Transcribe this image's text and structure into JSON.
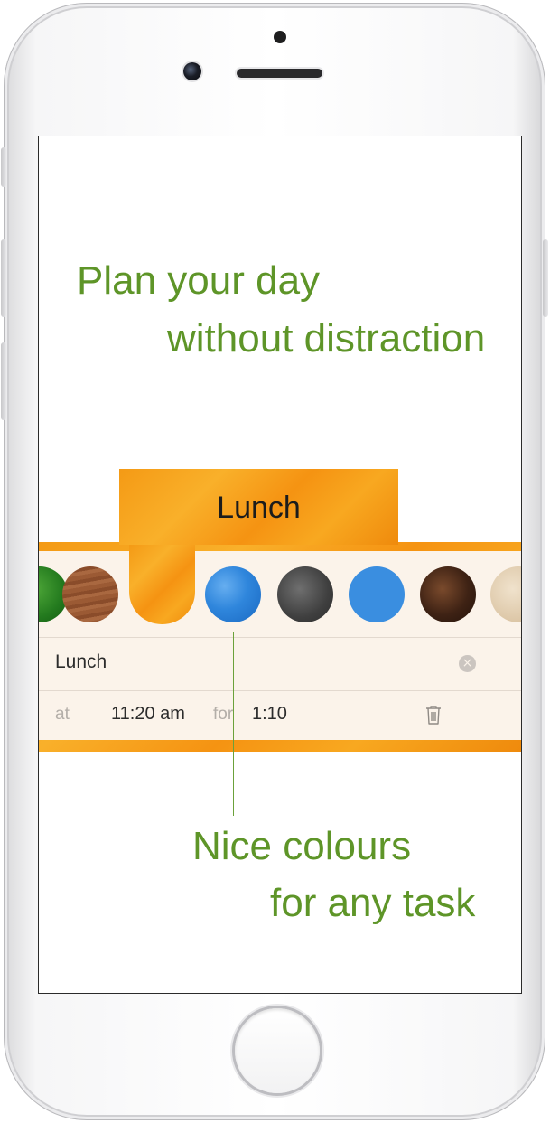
{
  "headline": {
    "line1": "Plan your day",
    "line2": "without distraction"
  },
  "task_tab": {
    "title": "Lunch"
  },
  "color_picker": {
    "swatches": [
      {
        "icon": "green-swatch",
        "color": "#2e8a24"
      },
      {
        "icon": "wood-swatch",
        "color": "#995633"
      },
      {
        "icon": "orange-swatch",
        "color": "#f59a15",
        "selected": true
      },
      {
        "icon": "blue-texture-swatch",
        "color": "#2f86dc"
      },
      {
        "icon": "gray-texture-swatch",
        "color": "#4a4a4a"
      },
      {
        "icon": "blue-swatch",
        "color": "#3a8ee0"
      },
      {
        "icon": "coffee-swatch",
        "color": "#4a2a18"
      },
      {
        "icon": "sand-swatch",
        "color": "#e6d4b8"
      }
    ]
  },
  "task_form": {
    "name_value": "Lunch",
    "at_label": "at",
    "time_value": "11:20 am",
    "for_label": "for",
    "duration_value": "1:10"
  },
  "caption": {
    "line1": "Nice colours",
    "line2": "for any task"
  },
  "colors": {
    "accent_green": "#5e9528",
    "orange": "#f59a15"
  }
}
